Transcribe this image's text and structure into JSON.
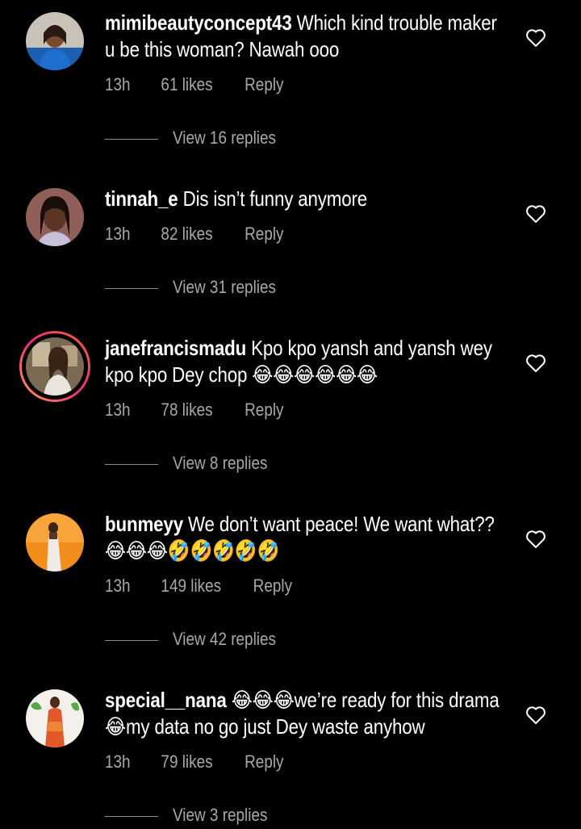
{
  "colors": {
    "background": "#000000",
    "text": "#ffffff",
    "muted": "#a8a8a8",
    "divider": "#8a8a8a",
    "story_ring_start": "#f9a24a",
    "story_ring_end": "#ee2a7b"
  },
  "comments": [
    {
      "username": "mimibeautyconcept43",
      "text": "Which kind trouble maker u be this woman? Nawah ooo",
      "time": "13h",
      "likes": "61 likes",
      "reply_label": "Reply",
      "view_replies": "View 16 replies",
      "icon": "heart-outline-icon"
    },
    {
      "username": "tinnah_e",
      "text": "Dis isn’t funny anymore",
      "time": "13h",
      "likes": "82 likes",
      "reply_label": "Reply",
      "view_replies": "View 31 replies",
      "icon": "heart-outline-icon"
    },
    {
      "username": "janefrancismadu",
      "text": "Kpo kpo yansh and yansh wey kpo kpo Dey chop 😂😂😂😂😂😂",
      "time": "13h",
      "likes": "78 likes",
      "reply_label": "Reply",
      "view_replies": "View 8 replies",
      "icon": "heart-outline-icon",
      "has_story": true
    },
    {
      "username": "bunmeyy",
      "text": "We don’t want peace! We want what?? 😂😂😂🤣🤣🤣🤣🤣",
      "time": "13h",
      "likes": "149 likes",
      "reply_label": "Reply",
      "view_replies": "View 42 replies",
      "icon": "heart-outline-icon"
    },
    {
      "username": "special__nana",
      "text": "😂😂😂we’re ready for this drama 😂my data no go just Dey waste anyhow",
      "time": "13h",
      "likes": "79 likes",
      "reply_label": "Reply",
      "view_replies": "View 3 replies",
      "icon": "heart-outline-icon"
    }
  ]
}
